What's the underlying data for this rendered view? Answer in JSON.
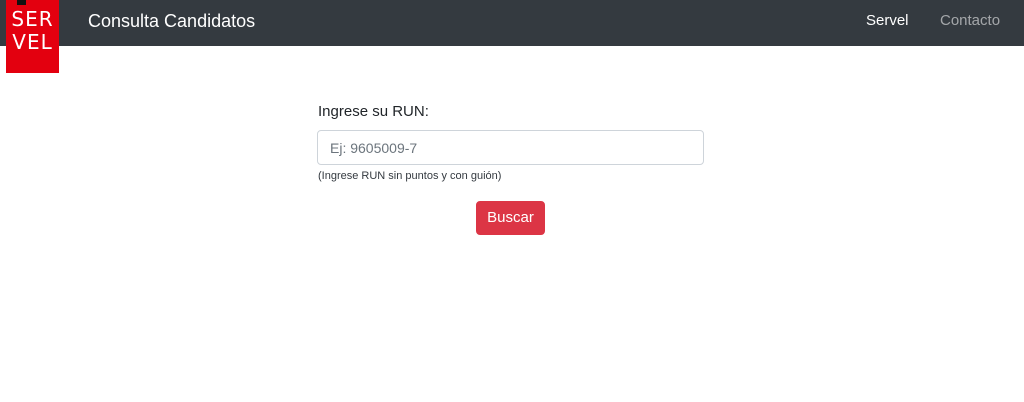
{
  "navbar": {
    "logo_text": "SER\nVEL",
    "brand": "Consulta Candidatos",
    "links": [
      {
        "label": "Servel"
      },
      {
        "label": "Contacto"
      }
    ]
  },
  "form": {
    "label": "Ingrese su RUN:",
    "input_placeholder": "Ej: 9605009-7",
    "input_value": "",
    "help_text": "(Ingrese RUN sin puntos y con guión)",
    "submit_label": "Buscar"
  },
  "colors": {
    "navbar_bg": "#343a40",
    "logo_bg": "#e3000f",
    "button_bg": "#dc3545"
  }
}
